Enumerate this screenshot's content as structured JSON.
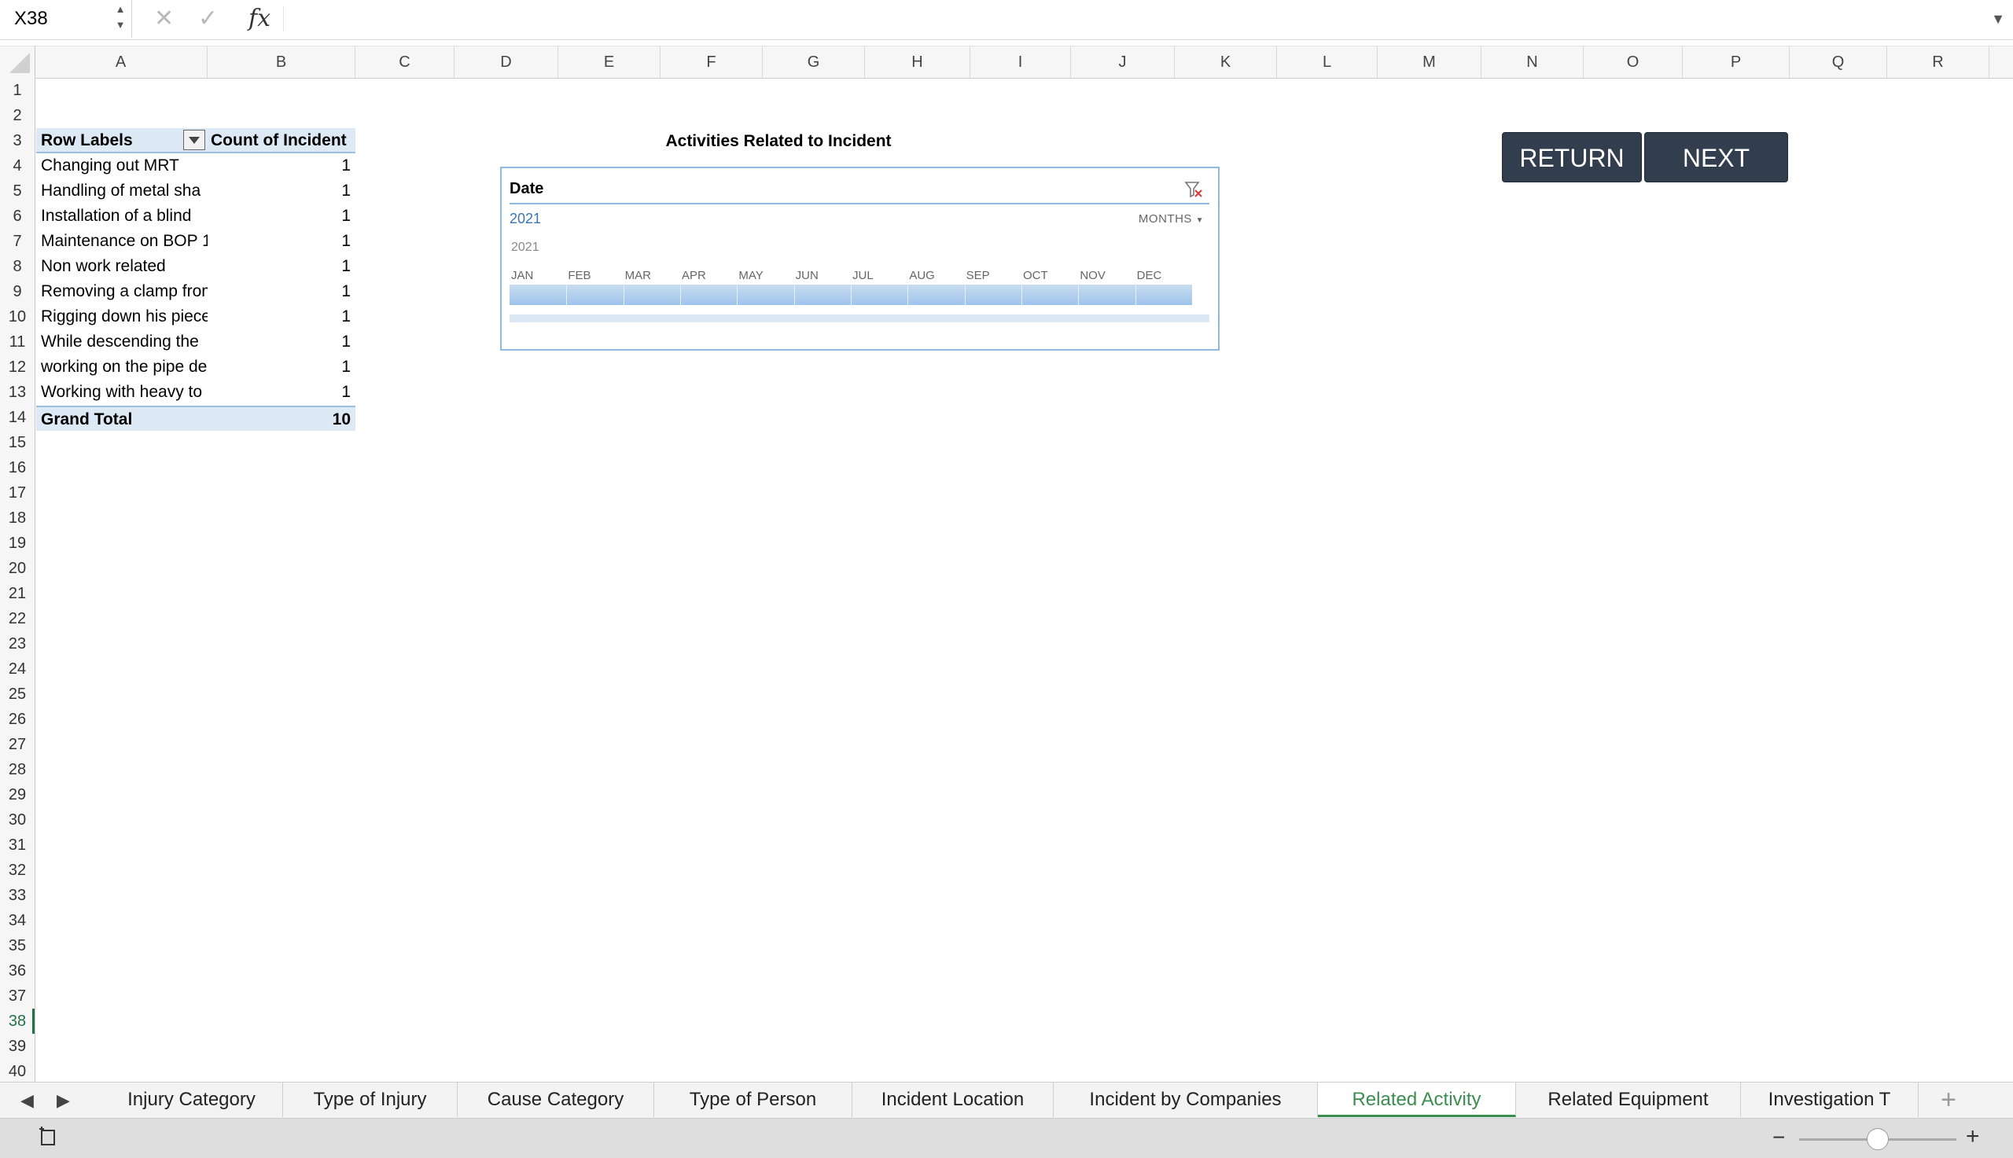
{
  "formula_bar": {
    "name_box": "X38",
    "cancel_icon": "close-icon",
    "enter_icon": "check-icon",
    "fx_label": "fx",
    "formula": ""
  },
  "columns": [
    "A",
    "B",
    "C",
    "D",
    "E",
    "F",
    "G",
    "H",
    "I",
    "J",
    "K",
    "L",
    "M",
    "N",
    "O",
    "P",
    "Q",
    "R"
  ],
  "rows": [
    "1",
    "2",
    "3",
    "4",
    "5",
    "6",
    "7",
    "8",
    "9",
    "10",
    "11",
    "12",
    "13",
    "14",
    "15",
    "16",
    "17",
    "18",
    "19",
    "20",
    "21",
    "22",
    "23",
    "24",
    "25",
    "26",
    "27",
    "28",
    "29",
    "30",
    "31",
    "32",
    "33",
    "34",
    "35",
    "36",
    "37",
    "38",
    "39",
    "40"
  ],
  "active_row": "38",
  "pivot": {
    "header_label": "Row Labels",
    "header_value": "Count of Incident",
    "rows": [
      {
        "label": "Changing out MRT",
        "value": "1"
      },
      {
        "label": "Handling of metal sha",
        "value": "1"
      },
      {
        "label": "Installation of a blind",
        "value": "1"
      },
      {
        "label": "Maintenance on BOP 1",
        "value": "1"
      },
      {
        "label": "Non work related",
        "value": "1"
      },
      {
        "label": "Removing a clamp from",
        "value": "1"
      },
      {
        "label": "Rigging down his piece",
        "value": "1"
      },
      {
        "label": "While descending the",
        "value": "1"
      },
      {
        "label": "working on the pipe de",
        "value": "1"
      },
      {
        "label": "Working with heavy to",
        "value": "1"
      }
    ],
    "total_label": "Grand Total",
    "total_value": "10"
  },
  "chart_title": "Activities Related to Incident",
  "timeline": {
    "header": "Date",
    "selection": "2021",
    "level": "MONTHS",
    "year_band": "2021",
    "months": [
      "JAN",
      "FEB",
      "MAR",
      "APR",
      "MAY",
      "JUN",
      "JUL",
      "AUG",
      "SEP",
      "OCT",
      "NOV",
      "DEC"
    ]
  },
  "buttons": {
    "return": "RETURN",
    "next": "NEXT"
  },
  "sheet_tabs": [
    {
      "label": "Injury Category",
      "active": false
    },
    {
      "label": "Type of Injury",
      "active": false
    },
    {
      "label": "Cause Category",
      "active": false
    },
    {
      "label": "Type of Person",
      "active": false
    },
    {
      "label": "Incident Location",
      "active": false
    },
    {
      "label": "Incident by Companies",
      "active": false
    },
    {
      "label": "Related Activity",
      "active": true
    },
    {
      "label": "Related Equipment",
      "active": false
    },
    {
      "label": "Investigation T",
      "active": false
    }
  ],
  "colors": {
    "accent": "#217346",
    "button_bg": "#323e4e",
    "pivot_header": "#dde9f5",
    "timeline_border": "#8eb9e0",
    "timeline_bar": "#9ec4ea"
  }
}
